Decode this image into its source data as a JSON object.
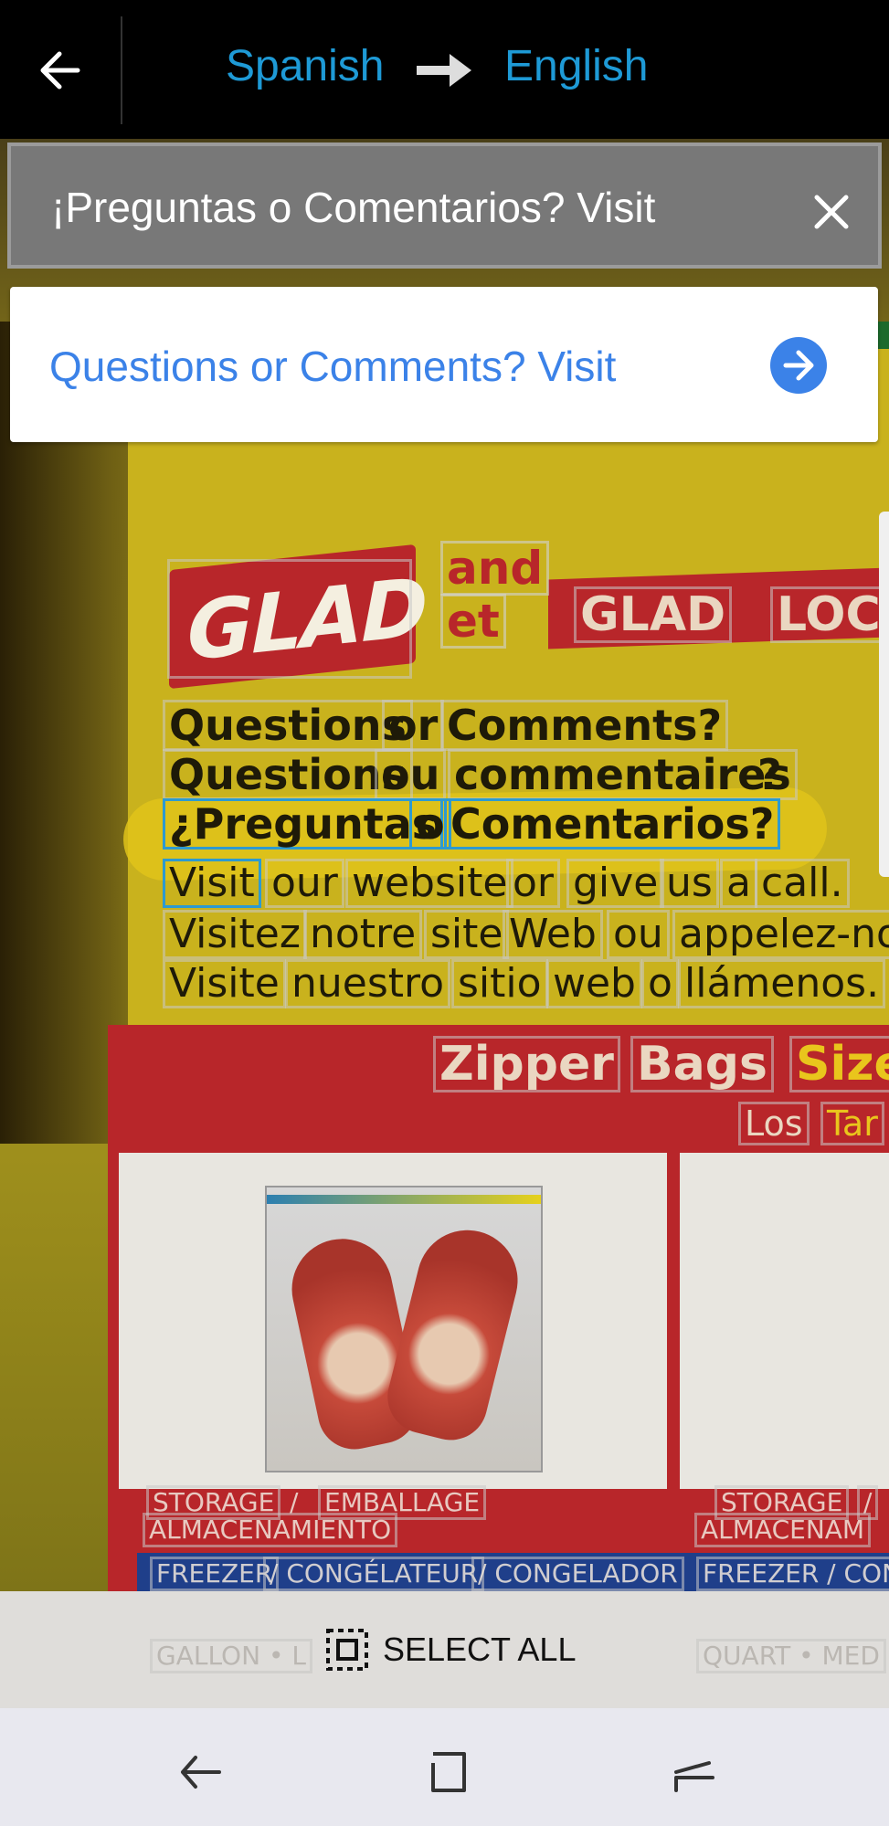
{
  "header": {
    "source_language": "Spanish",
    "target_language": "English"
  },
  "query": {
    "text": "¡Preguntas o Comentarios? Visit"
  },
  "result": {
    "translation": "Questions or Comments? Visit"
  },
  "camera_text": {
    "brand_left": "GLAD",
    "and_word": "and",
    "et_word": "et",
    "brand_right_a": "GLAD",
    "brand_right_b": "LOC",
    "line1": [
      "Questions",
      "or",
      "Comments?"
    ],
    "line2": [
      "Questions",
      "ou",
      "commentaires",
      "?"
    ],
    "line3": [
      "¿Preguntas",
      "o",
      "Comentarios?"
    ],
    "line4": [
      "Visit",
      "our",
      "website",
      "or",
      "give",
      "us",
      "a",
      "call."
    ],
    "line5": [
      "Visitez",
      "notre",
      "site",
      "Web",
      "ou",
      "appelez-no"
    ],
    "line6": [
      "Visite",
      "nuestro",
      "sitio",
      "web",
      "o",
      "llámenos."
    ],
    "zipper": [
      "Zipper",
      "Bags",
      "Size"
    ],
    "los": [
      "Los",
      "Tar"
    ],
    "storage_left": [
      "STORAGE",
      "/",
      "EMBALLAGE"
    ],
    "almacen_left": "ALMACENAMIENTO",
    "storage_right": [
      "STORAGE",
      "/"
    ],
    "almacen_right": "ALMACENAM",
    "freezer_left": [
      "FREEZER",
      "/ CONGÉLATEUR",
      "/ CONGELADOR"
    ],
    "freezer_right": "FREEZER / CON",
    "gallon": "GALLON • L",
    "quart": "QUART • MED"
  },
  "bottom": {
    "select_all": "SELECT ALL"
  },
  "colors": {
    "accent_blue": "#1e9ad6",
    "result_blue": "#3b82e8",
    "highlight_yellow": "#e0c31a"
  },
  "icons": [
    "back-arrow-icon",
    "right-arrow-icon",
    "close-icon",
    "go-arrow-icon",
    "select-all-icon",
    "nav-back-icon",
    "nav-home-icon",
    "nav-recents-icon"
  ]
}
